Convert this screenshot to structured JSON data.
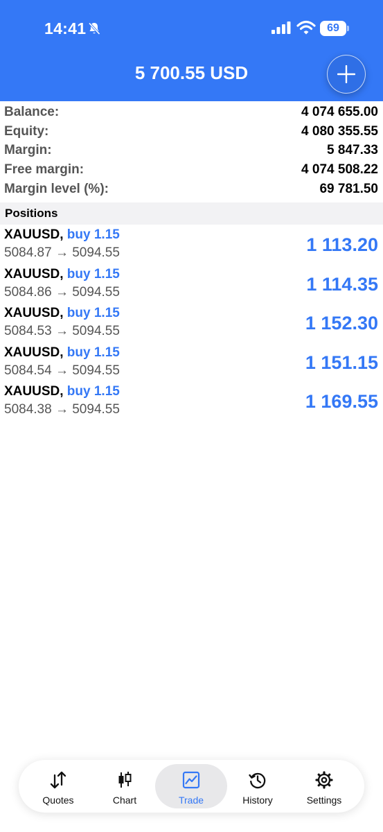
{
  "status_bar": {
    "time": "14:41",
    "battery": "69"
  },
  "header": {
    "total": "5 700.55 USD"
  },
  "summary": [
    {
      "label": "Balance:",
      "value": "4 074 655.00"
    },
    {
      "label": "Equity:",
      "value": "4 080 355.55"
    },
    {
      "label": "Margin:",
      "value": "5 847.33"
    },
    {
      "label": "Free margin:",
      "value": "4 074 508.22"
    },
    {
      "label": "Margin level (%):",
      "value": "69 781.50"
    }
  ],
  "positions_title": "Positions",
  "positions": [
    {
      "symbol": "XAUUSD,",
      "direction": "buy 1.15",
      "prices": "5084.87 → 5094.55",
      "profit": "1 113.20"
    },
    {
      "symbol": "XAUUSD,",
      "direction": "buy 1.15",
      "prices": "5084.86 → 5094.55",
      "profit": "1 114.35"
    },
    {
      "symbol": "XAUUSD,",
      "direction": "buy 1.15",
      "prices": "5084.53 → 5094.55",
      "profit": "1 152.30"
    },
    {
      "symbol": "XAUUSD,",
      "direction": "buy 1.15",
      "prices": "5084.54 → 5094.55",
      "profit": "1 151.15"
    },
    {
      "symbol": "XAUUSD,",
      "direction": "buy 1.15",
      "prices": "5084.38 → 5094.55",
      "profit": "1 169.55"
    }
  ],
  "tabs": [
    {
      "label": "Quotes",
      "icon": "quotes-arrows-icon"
    },
    {
      "label": "Chart",
      "icon": "candlestick-icon"
    },
    {
      "label": "Trade",
      "icon": "trade-chart-icon",
      "active": true
    },
    {
      "label": "History",
      "icon": "history-clock-icon"
    },
    {
      "label": "Settings",
      "icon": "gear-icon"
    }
  ],
  "colors": {
    "accent": "#3478f6",
    "header_bg": "#3478f6",
    "section_bg": "#f2f2f4"
  }
}
